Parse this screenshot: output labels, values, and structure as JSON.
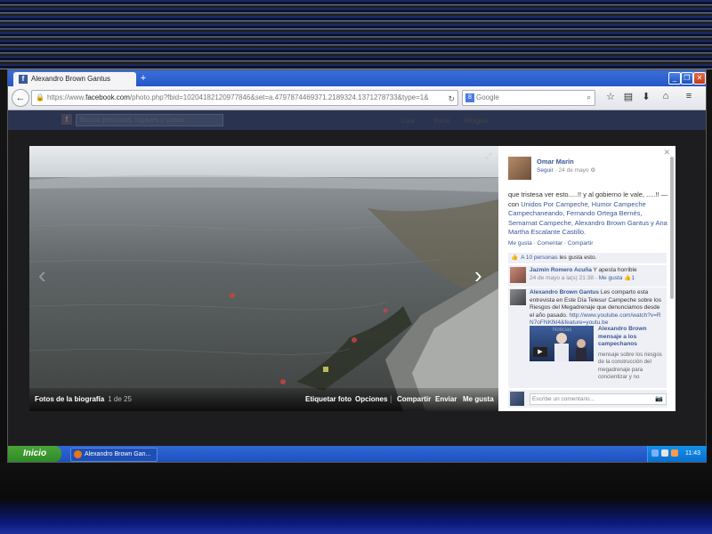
{
  "browser": {
    "tab_title": "Alexandro Brown Gantus",
    "new_tab": "+",
    "url_prefix": "https://www.",
    "url_domain": "facebook.com",
    "url_rest": "/photo.php?fbid=10204182120977846&set=a.4797874469371.2189324.1371278733&type=1&",
    "search_engine": "Google",
    "search_placeholder": "Google"
  },
  "facebook_bg": {
    "search_placeholder": "Busca personas, lugares y cosas",
    "dim_items": [
      "Lisa",
      "Inicio",
      "Amigos"
    ]
  },
  "photo_viewer": {
    "album_title": "Fotos de la biografía",
    "counter": "1 de 25",
    "actions": [
      "Etiquetar foto",
      "Opciones",
      "Compartir",
      "Enviar",
      "Me gusta"
    ]
  },
  "post": {
    "author": "Omar Marín",
    "follow": "Seguir",
    "date": "24 de mayo",
    "text_plain": "que tristesa ver esto.....!! y al gobierno le vale, .....!! — con",
    "tagged": "Unidos Por Campeche, Humor Campeche Campechaneando, Fernando Ortega Bernés, Semarnat Campeche, Alexandro Brown Gantus y Ana Martha Escalante Castillo.",
    "actions": [
      "Me gusta",
      "Comentar",
      "Compartir"
    ],
    "likes_link": "A 10 personas",
    "likes_rest": "les gusta esto."
  },
  "comments": [
    {
      "author": "Jazmín Romero Acuña",
      "text": "Y apesta horrible",
      "time": "24 de mayo a la(s) 21:38",
      "like_label": "Me gusta",
      "like_count": "1"
    },
    {
      "author": "Alexandro Brown Gantus",
      "text": "Les comparto esta entrevista en Este Día Telesur Campeche sobre los Riesgos del Megadrenaje que denunciamos desde el año pasado.",
      "link": "http://www.youtube.com/watch?v=RN7oFNKfkl4&feature=youtu.be"
    }
  ],
  "video": {
    "thumb_label": "Noticias",
    "title": "Alexandro Brown mensaje a los campechanos",
    "description": "mensaje sobre los riesgos de la construcción del megadrenaje para concientizar y no"
  },
  "comment_box": {
    "placeholder": "Escribe un comentario..."
  },
  "taskbar": {
    "start": "Inicio",
    "window": "Alexandro Brown Gan...",
    "clock": "11:43"
  }
}
